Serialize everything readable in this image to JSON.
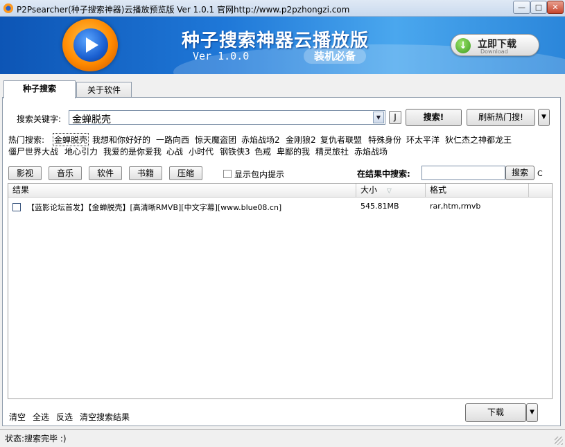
{
  "window": {
    "title": "P2Psearcher(种子搜索神器)云播放预览版 Ver 1.0.1 官网http://www.p2pzhongzi.com",
    "minimize_icon": "minimize-icon",
    "maximize_icon": "maximize-icon",
    "close_icon": "close-icon"
  },
  "banner": {
    "title": "种子搜索神器云播放版",
    "version": "Ver 1.0.0",
    "badge": "装机必备",
    "download_label": "立即下载",
    "download_sub": "Download"
  },
  "tabs": [
    {
      "label": "种子搜索",
      "active": true
    },
    {
      "label": "关于软件",
      "active": false
    }
  ],
  "search": {
    "keyword_label": "搜索关键字:",
    "keyword_value": "金蝉脱壳",
    "j_button": "J",
    "search_button": "搜索!",
    "refresh_button": "刷新热门搜!"
  },
  "hot": {
    "label": "热门搜索:",
    "words_row1": [
      "金蝉脱壳",
      "我想和你好好的",
      "一路向西",
      "惊天魔盗团",
      "赤焰战场2",
      "金刚狼2",
      "复仇者联盟",
      "特殊身份",
      "环太平洋",
      "狄仁杰之神都龙王"
    ],
    "words_row2": [
      "僵尸世界大战",
      "地心引力",
      "我爱的是你爱我",
      "心战",
      "小时代",
      "钢铁侠3",
      "色戒",
      "卑鄙的我",
      "精灵旅社",
      "赤焰战场"
    ]
  },
  "categories": [
    "影视",
    "音乐",
    "软件",
    "书籍",
    "压缩"
  ],
  "options": {
    "show_hint_label": "显示包内提示",
    "show_hint_checked": false,
    "in_results_label": "在结果中搜索:",
    "in_results_value": "",
    "in_results_button": "搜索",
    "trailing_char": "C"
  },
  "table": {
    "columns": [
      "结果",
      "大小",
      "格式"
    ],
    "rows": [
      {
        "checked": false,
        "name": "【蓝影论坛首发】【金蝉脱壳】[高清晰RMVB][中文字幕][www.blue08.cn]",
        "size": "545.81MB",
        "format": "rar,htm,rmvb"
      }
    ]
  },
  "footer": {
    "clear": "清空",
    "select_all": "全选",
    "invert": "反选",
    "clear_results": "清空搜索结果",
    "download_button": "下载"
  },
  "status": {
    "text": "状态:搜索完毕 :)"
  }
}
